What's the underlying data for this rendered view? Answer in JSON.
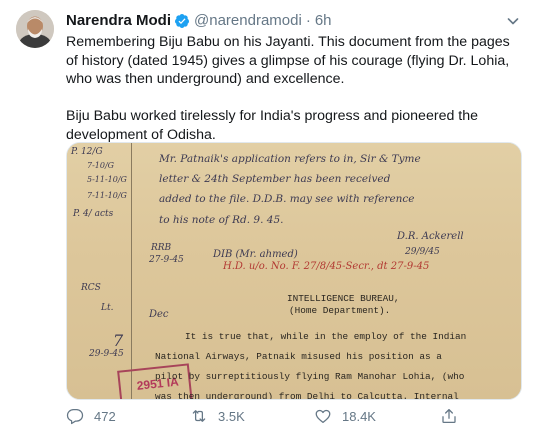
{
  "tweet": {
    "display_name": "Narendra Modi",
    "handle": "@narendramodi",
    "separator": "·",
    "time": "6h",
    "paragraphs": [
      "Remembering Biju Babu on his Jayanti. This document from the pages of history (dated 1945) gives a glimpse of his courage (flying Dr. Lohia, who was then underground) and excellence.",
      "Biju Babu worked tirelessly for India's progress and pioneered the development of Odisha."
    ]
  },
  "document": {
    "hand_lines": [
      "Mr. Patnaik's application refers to in, Sir & Tyme",
      "letter & 24th September has been received",
      "added to the file. D.D.B. may see with reference",
      "to his note of Rd. 9. 45.",
      "D.R. Ackerell",
      "29/9/45"
    ],
    "margin_notes": [
      "P. 12/G",
      "7-10/G",
      "5-11-10/G",
      "7-11-10/G",
      "P. 4/ acts",
      "RRB",
      "27-9-45",
      "RCS",
      "Lt.",
      "Dec",
      "7",
      "29-9-45"
    ],
    "red_line": "H.D. u/o. No. F. 27/8/45-Secr., dt 27-9-45",
    "dib": "DIB (Mr. ahmed)",
    "stamp": "2951 IA",
    "typed_header": [
      "INTELLIGENCE BUREAU,",
      "(Home Department)."
    ],
    "typed_body": [
      "It is true that, while in the employ of the Indian",
      "National Airways, Patnaik misused his position as a",
      "pilot by surreptitiously flying Ram Manohar Lohia, (who",
      "was then underground) from Delhi to Calcutta. Internal"
    ]
  },
  "actions": {
    "replies": "472",
    "retweets": "3.5K",
    "likes": "18.4K"
  },
  "colors": {
    "text": "#14171a",
    "secondary": "#657786",
    "verified": "#1da1f2",
    "border": "#e1e8ed"
  }
}
